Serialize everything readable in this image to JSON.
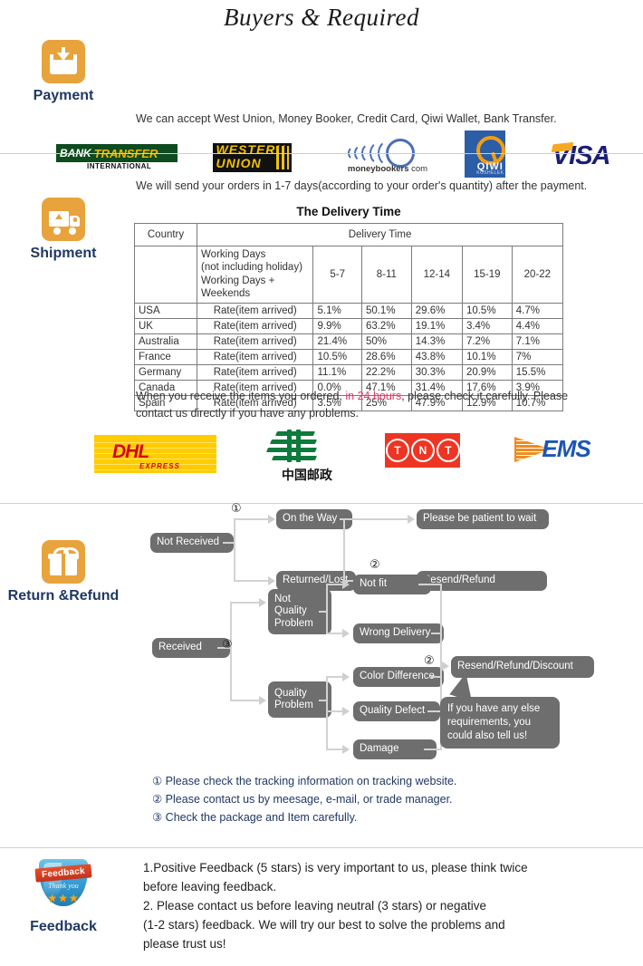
{
  "title": "Buyers & Required",
  "sections": {
    "payment": {
      "label": "Payment",
      "icon": "inbox-download-icon",
      "intro": "We can accept West Union, Money Booker, Credit Card, Qiwi Wallet, Bank Transfer.",
      "logos": [
        {
          "name": "bank-transfer-logo",
          "line1": "BANK",
          "line2": "TRANSFER",
          "sub": "INTERNATIONAL"
        },
        {
          "name": "western-union-logo",
          "line1": "WESTERN",
          "line2": "UNION"
        },
        {
          "name": "moneybookers-logo",
          "text": "moneybookers",
          "suffix": "com"
        },
        {
          "name": "qiwi-logo",
          "text": "QIWI",
          "sub": "KOSHELEK"
        },
        {
          "name": "visa-logo",
          "text": "VISA"
        }
      ]
    },
    "shipment": {
      "label": "Shipment",
      "icon": "truck-icon",
      "intro": "We will send your orders in 1-7 days(according to your order's quantity) after the payment.",
      "table_title": "The Delivery Time",
      "notice_before": "When you receive the items you ordered, ",
      "notice_highlight": "in 24 hours",
      "notice_after": ", please check it carefully. Please contact us directly if you have any problems.",
      "highlight_color": "#e2386a",
      "carriers": [
        {
          "name": "dhl-logo",
          "text": "DHL",
          "sub": "EXPRESS"
        },
        {
          "name": "china-post-logo",
          "text": "中国邮政"
        },
        {
          "name": "tnt-logo",
          "letters": [
            "T",
            "N",
            "T"
          ]
        },
        {
          "name": "ems-logo",
          "text": "EMS"
        }
      ]
    },
    "return": {
      "label": "Return &Refund",
      "icon": "gift-icon",
      "flow": {
        "not_received": "Not Received",
        "on_the_way": "On the Way",
        "returned_lost": "Returned/Lost",
        "please_wait": "Please be patient to wait",
        "resend_refund": "Resend/Refund",
        "received": "Received",
        "not_quality_problem": "Not\nQuality\nProblem",
        "not_fit": "Not fit",
        "wrong_delivery": "Wrong Delivery",
        "quality_problem": "Quality\nProblem",
        "color_difference": "Color Difference",
        "quality_defect": "Quality Defect",
        "damage": "Damage",
        "resend_refund_discount": "Resend/Refund/Discount",
        "callout": "If you have any else requirements, you could also tell us!",
        "marker1": "①",
        "marker2": "②",
        "marker2b": "②",
        "marker2c": "②",
        "marker3": "③"
      },
      "notes": [
        "① Please check the tracking information on tracking website.",
        "② Please contact us by meesage, e-mail, or trade manager.",
        "③ Check the package and Item carefully."
      ]
    },
    "feedback": {
      "label": "Feedback",
      "icon": "feedback-shield-icon",
      "badge_title": "Feedback",
      "badge_sub": "Thank you",
      "badge_stars": "★★★",
      "lines": [
        "1.Positive Feedback (5 stars) is very important to us, please think twice",
        " before leaving feedback.",
        "2. Please contact us before leaving neutral (3 stars) or negative",
        "(1-2 stars) feedback. We will try our best to solve the problems and",
        " please trust us!"
      ]
    }
  },
  "delivery_table": {
    "header_country": "Country",
    "header_delivery": "Delivery Time",
    "working_days_label": "Working Days\n(not including holiday)\nWorking Days + Weekends",
    "ranges": [
      "5-7",
      "8-11",
      "12-14",
      "15-19",
      "20-22"
    ],
    "rate_label": "Rate(item arrived)",
    "rows": [
      {
        "country": "USA",
        "values": [
          "5.1%",
          "50.1%",
          "29.6%",
          "10.5%",
          "4.7%"
        ]
      },
      {
        "country": "UK",
        "values": [
          "9.9%",
          "63.2%",
          "19.1%",
          "3.4%",
          "4.4%"
        ]
      },
      {
        "country": "Australia",
        "values": [
          "21.4%",
          "50%",
          "14.3%",
          "7.2%",
          "7.1%"
        ]
      },
      {
        "country": "France",
        "values": [
          "10.5%",
          "28.6%",
          "43.8%",
          "10.1%",
          "7%"
        ]
      },
      {
        "country": "Germany",
        "values": [
          "11.1%",
          "22.2%",
          "30.3%",
          "20.9%",
          "15.5%"
        ]
      },
      {
        "country": "Canada",
        "values": [
          "0.0%",
          "47.1%",
          "31.4%",
          "17.6%",
          "3.9%"
        ]
      },
      {
        "country": "Spain",
        "values": [
          "3.5%",
          "25%",
          "47.9%",
          "12.9%",
          "10.7%"
        ]
      }
    ]
  },
  "colors": {
    "icon_orange": "#E8A33D",
    "label_navy": "#1F3864",
    "node_gray": "#6E6E6E",
    "highlight_red": "#e2386a"
  }
}
